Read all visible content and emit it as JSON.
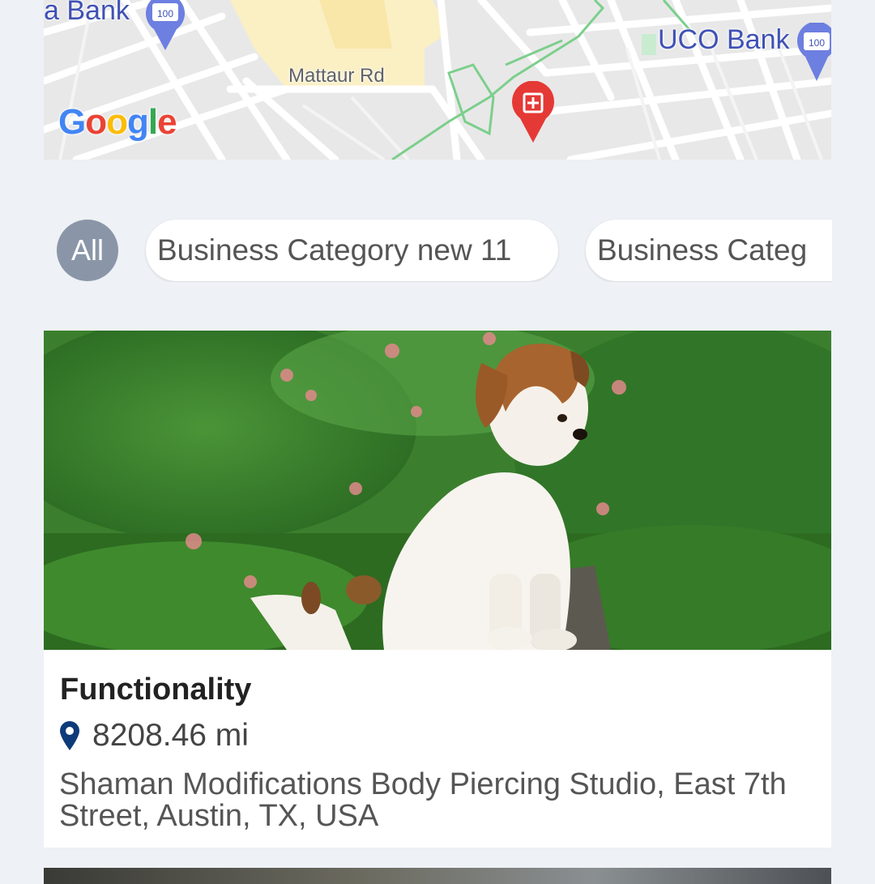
{
  "map": {
    "road_label": "Mattaur Rd",
    "bank_left_label": "a Bank",
    "bank_right_label": "UCO Bank",
    "atm_badge": "100",
    "google_logo": [
      "G",
      "o",
      "o",
      "g",
      "l",
      "e"
    ],
    "google_colors": [
      "#4285F4",
      "#EA4335",
      "#FBBC05",
      "#4285F4",
      "#34A853",
      "#EA4335"
    ]
  },
  "filters": {
    "all_label": "All",
    "categories": [
      "Business Category new 11",
      "Business Categ"
    ]
  },
  "listing": {
    "title": "Functionality",
    "distance": "8208.46 mi",
    "address": "Shaman Modifications Body Piercing Studio, East 7th Street, Austin, TX, USA"
  },
  "colors": {
    "background": "#eef1f5",
    "chip_all_bg": "#8a96a8",
    "pin_blue": "#0d3b7a",
    "bank_text": "#3f51b5",
    "hospital_pin": "#e53935"
  }
}
